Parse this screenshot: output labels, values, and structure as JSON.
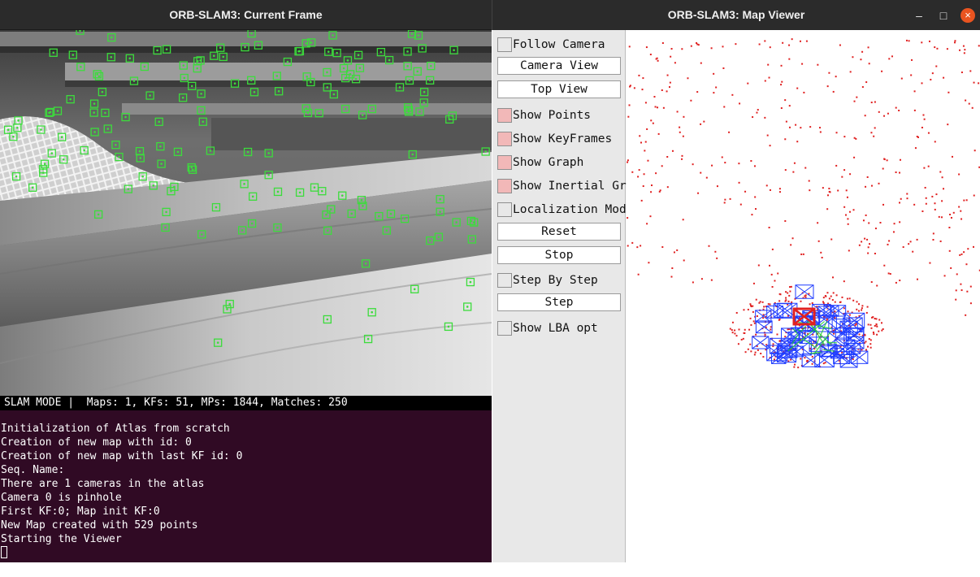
{
  "windows": {
    "current_frame": {
      "title": "ORB-SLAM3: Current Frame"
    },
    "map_viewer": {
      "title": "ORB-SLAM3: Map Viewer",
      "controls": {
        "minimize": "–",
        "maximize": "□",
        "close": "×"
      }
    }
  },
  "status_bar": {
    "text": "SLAM MODE |  Maps: 1, KFs: 51, MPs: 1844, Matches: 250"
  },
  "terminal": {
    "lines": [
      "Initialization of Atlas from scratch",
      "Creation of new map with id: 0",
      "Creation of new map with last KF id: 0",
      "Seq. Name:",
      "There are 1 cameras in the atlas",
      "Camera 0 is pinhole",
      "First KF:0; Map init KF:0",
      "New Map created with 529 points",
      "Starting the Viewer"
    ]
  },
  "panel": {
    "follow_camera": {
      "label": "Follow Camera",
      "checked": false
    },
    "camera_view": {
      "label": "Camera View"
    },
    "top_view": {
      "label": "Top View"
    },
    "show_points": {
      "label": "Show Points",
      "checked": true
    },
    "show_keyframes": {
      "label": "Show KeyFrames",
      "checked": true
    },
    "show_graph": {
      "label": "Show Graph",
      "checked": true
    },
    "show_inertial_graph": {
      "label": "Show Inertial Graph",
      "checked": true
    },
    "localization_mode": {
      "label": "Localization Mode",
      "checked": false
    },
    "reset": {
      "label": "Reset"
    },
    "stop": {
      "label": "Stop"
    },
    "step_by_step": {
      "label": "Step By Step",
      "checked": false
    },
    "step": {
      "label": "Step"
    },
    "show_lba_opt": {
      "label": "Show LBA opt",
      "checked": false
    }
  },
  "colors": {
    "feature": "#3cdc3c",
    "map_point": "#e02020",
    "keyframe": "#1f3cff",
    "current_camera": "#e02020",
    "graph_edge": "#22cc33",
    "terminal_bg": "#300a24",
    "checkbox_on": "#f2b8b8"
  }
}
